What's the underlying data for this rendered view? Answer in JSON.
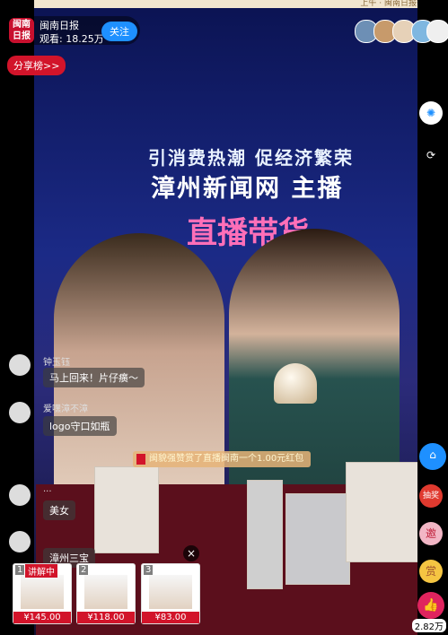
{
  "top_notice": "上午 · 闽南日报举报会",
  "anchor": {
    "logo_text": "闽南\n日报",
    "name": "闽南日报",
    "views": "观看: 18.25万",
    "follow_label": "关注"
  },
  "share_rank_label": "分享榜>>",
  "stage": {
    "headline_line1": "引消费热潮  促经济繁荣",
    "headline_line2": "漳州新闻网 主播",
    "show_logo": "直播带货"
  },
  "chat": [
    {
      "name": "钟玉钰",
      "message": "马上回来！片仔癀～"
    },
    {
      "name": "爱嘿漳不漳",
      "message": "logo守口如瓶"
    },
    {
      "name": "...",
      "message": "美女"
    },
    {
      "name": "",
      "message": "漳州三宝"
    }
  ],
  "gift_banner": "闽貌强赞赏了直播闽南一个1.00元红包",
  "products": [
    {
      "index": "1",
      "price": "¥145.00",
      "tag": "讲解中"
    },
    {
      "index": "2",
      "price": "¥118.00"
    },
    {
      "index": "3",
      "price": "¥83.00"
    }
  ],
  "side_buttons": {
    "lottery": "抽奖",
    "invite": "邀",
    "reward": "赏"
  },
  "like_count": "2.82万",
  "colors": {
    "brand_red": "#d2142a",
    "follow_blue": "#1e90ff",
    "like_pink": "#e0245e"
  }
}
